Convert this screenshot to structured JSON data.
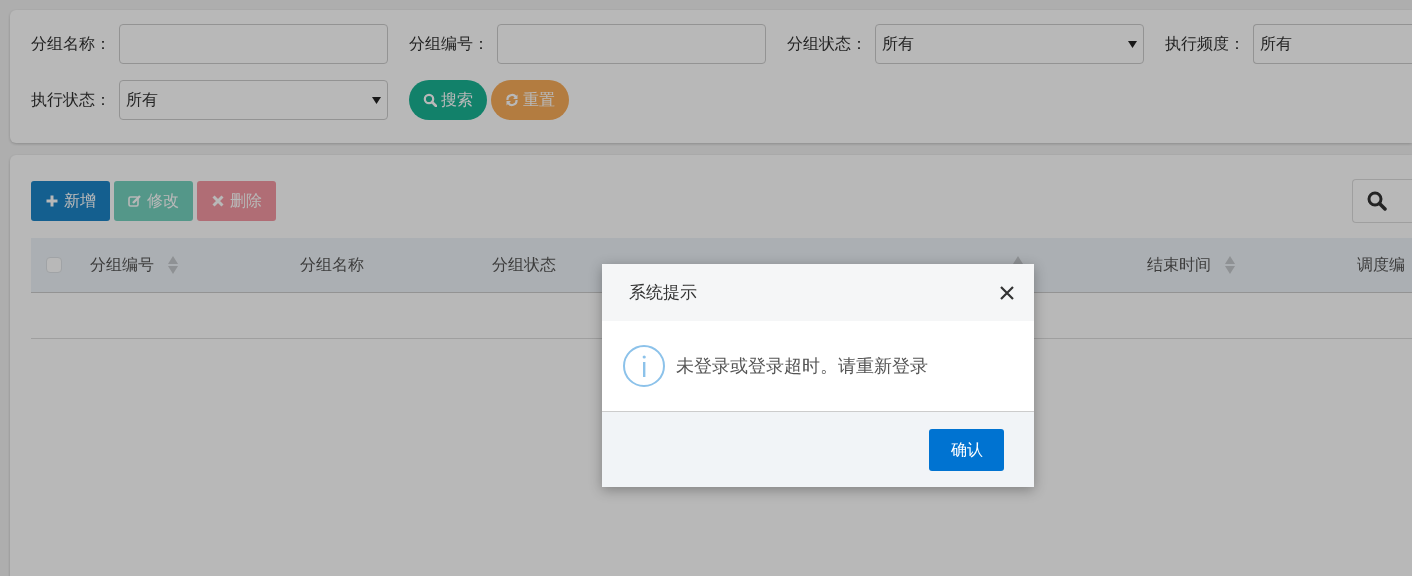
{
  "filter_rows": [
    {
      "fields": [
        {
          "label": "分组名称：",
          "kind": "text"
        },
        {
          "label": "分组编号：",
          "kind": "text"
        },
        {
          "label": "分组状态：",
          "kind": "select",
          "value": "所有"
        },
        {
          "label": "执行频度：",
          "kind": "select",
          "value": "所有",
          "cut": true
        }
      ]
    },
    {
      "fields": [
        {
          "label": "执行状态：",
          "kind": "select",
          "value": "所有"
        }
      ],
      "buttons": [
        {
          "label": "搜索",
          "kind": "search"
        },
        {
          "label": "重置",
          "kind": "reset"
        }
      ]
    }
  ],
  "toolbar": {
    "buttons": [
      {
        "label": "新增",
        "kind": "add",
        "disabled": false
      },
      {
        "label": "修改",
        "kind": "edit",
        "disabled": true
      },
      {
        "label": "删除",
        "kind": "delete",
        "disabled": true
      }
    ]
  },
  "table": {
    "select_all": {
      "checked": false
    },
    "columns": [
      {
        "label": "分组编号",
        "sortable": true
      },
      {
        "label": "分组名称",
        "sortable": false
      },
      {
        "label": "分组状态",
        "sortable": false
      },
      {
        "sortable": true
      },
      {
        "label": "结束时间",
        "sortable": true
      },
      {
        "label": "调度编",
        "sortable": false
      }
    ]
  },
  "dialog": {
    "title": "系统提示",
    "message": "未登录或登录超时。请重新登录",
    "buttons": [
      {
        "label": "确认",
        "kind": "primary"
      }
    ]
  }
}
